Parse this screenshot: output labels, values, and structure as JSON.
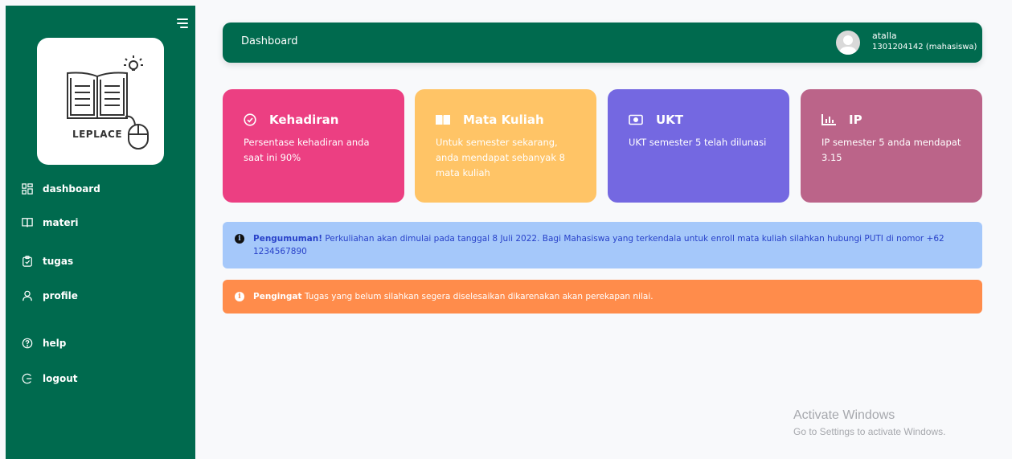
{
  "sidebar": {
    "logo_text": "LEPLACE",
    "items": [
      {
        "label": "dashboard",
        "icon": "dashboard-icon"
      },
      {
        "label": "materi",
        "icon": "book-icon"
      },
      {
        "label": "tugas",
        "icon": "clipboard-icon"
      },
      {
        "label": "profile",
        "icon": "user-icon"
      },
      {
        "label": "help",
        "icon": "help-icon"
      },
      {
        "label": "logout",
        "icon": "logout-icon"
      }
    ]
  },
  "header": {
    "title": "Dashboard",
    "user_name": "atalla",
    "user_id": "1301204142 (mahasiswa)"
  },
  "cards": [
    {
      "title": "Kehadiran",
      "text": "Persentase kehadiran anda saat ini 90%",
      "color": "#ec3f82",
      "icon": "check-circle-icon"
    },
    {
      "title": "Mata Kuliah",
      "text": "Untuk semester sekarang, anda mendapat sebanyak 8 mata kuliah",
      "color": "#ffc466",
      "icon": "book-open-icon"
    },
    {
      "title": "UKT",
      "text": "UKT semester 5 telah dilunasi",
      "color": "#7468e1",
      "icon": "money-icon"
    },
    {
      "title": "IP",
      "text": "IP semester 5 anda mendapat 3.15",
      "color": "#bb6489",
      "icon": "bar-chart-icon"
    }
  ],
  "alerts": {
    "info_label": "Pengumuman!",
    "info_text": " Perkuliahan akan dimulai pada tanggal 8 Juli 2022. Bagi Mahasiswa yang terkendala untuk enroll mata kuliah silahkan hubungi PUTI di nomor +62 1234567890",
    "warn_label": "Pengingat",
    "warn_text": " Tugas yang belum silahkan segera diselesaikan dikarenakan akan perekapan nilai."
  },
  "watermark": {
    "line1": "Activate Windows",
    "line2": "Go to Settings to activate Windows."
  },
  "colors": {
    "primary": "#006a4e",
    "info_bg": "#a5c8fa",
    "warn_bg": "#ff8c4b"
  }
}
